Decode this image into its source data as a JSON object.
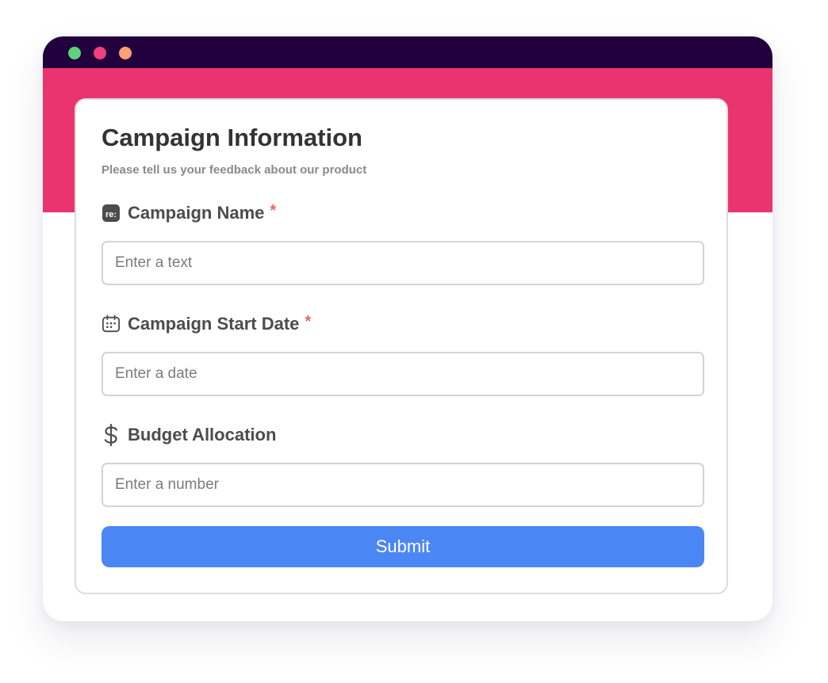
{
  "window": {
    "controls": [
      "green-dot",
      "red-dot",
      "orange-dot"
    ]
  },
  "form": {
    "title": "Campaign Information",
    "subtitle": "Please tell us your feedback about our product",
    "fields": [
      {
        "icon": "text-field-icon",
        "icon_text": "re:",
        "label": "Campaign Name",
        "required_mark": "*",
        "placeholder": "Enter a text"
      },
      {
        "icon": "calendar-icon",
        "label": "Campaign Start Date",
        "required_mark": "*",
        "placeholder": "Enter a date"
      },
      {
        "icon": "dollar-icon",
        "label": "Budget Allocation",
        "placeholder": "Enter a number"
      }
    ],
    "submit_label": "Submit"
  },
  "colors": {
    "titlebar": "#22003d",
    "banner": "#ea3470",
    "accent_button": "#4b86f5",
    "required_mark": "#f06262",
    "dot_green": "#5fd17a",
    "dot_red": "#ef3f7d",
    "dot_orange": "#f8a173"
  }
}
